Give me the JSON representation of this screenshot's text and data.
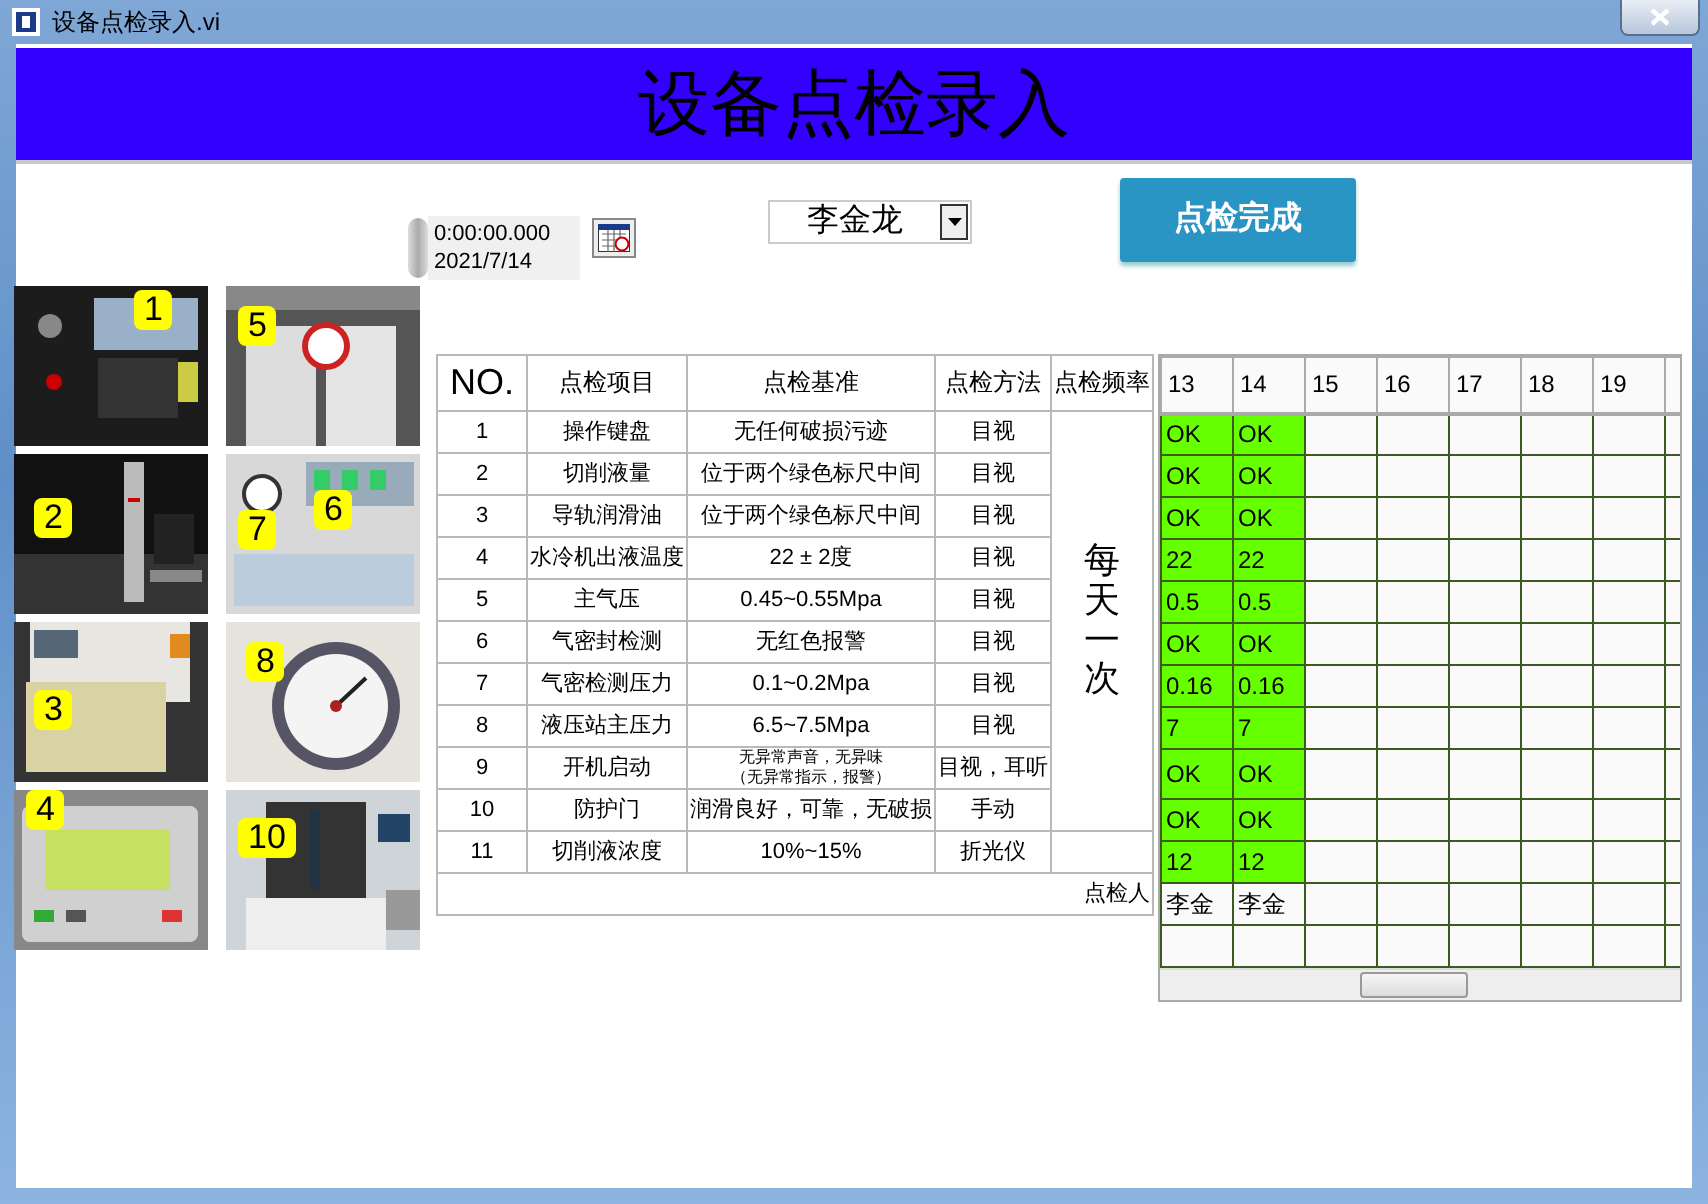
{
  "window": {
    "title": "设备点检录入.vi"
  },
  "banner": {
    "title": "设备点检录入"
  },
  "datetime": {
    "time": "0:00:00.000",
    "date": "2021/7/14"
  },
  "inspector_select": {
    "value": "李金龙"
  },
  "complete_button": {
    "label": "点检完成"
  },
  "photos": [
    {
      "kind": "picture",
      "callouts": [
        "1"
      ]
    },
    {
      "kind": "picture",
      "callouts": [
        "5"
      ]
    },
    {
      "kind": "picture",
      "callouts": [
        "2"
      ]
    },
    {
      "kind": "picture",
      "callouts": [
        "7",
        "6"
      ]
    },
    {
      "kind": "picture",
      "callouts": [
        "3"
      ]
    },
    {
      "kind": "picture",
      "callouts": [
        "8"
      ]
    },
    {
      "kind": "picture",
      "callouts": [
        "4"
      ]
    },
    {
      "kind": "picture",
      "callouts": [
        "10"
      ]
    }
  ],
  "checklist": {
    "columns": [
      "NO.",
      "点检项目",
      "点检基准",
      "点检方法",
      "点检频率"
    ],
    "frequency": "每天一次",
    "rows": [
      {
        "no": "1",
        "item": "操作键盘",
        "standard": "无任何破损污迹",
        "method": "目视"
      },
      {
        "no": "2",
        "item": "切削液量",
        "standard": "位于两个绿色标尺中间",
        "method": "目视"
      },
      {
        "no": "3",
        "item": "导轨润滑油",
        "standard": "位于两个绿色标尺中间",
        "method": "目视"
      },
      {
        "no": "4",
        "item": "水冷机出液温度",
        "standard": "22 ± 2度",
        "method": "目视"
      },
      {
        "no": "5",
        "item": "主气压",
        "standard": "0.45~0.55Mpa",
        "method": "目视"
      },
      {
        "no": "6",
        "item": "气密封检测",
        "standard": "无红色报警",
        "method": "目视"
      },
      {
        "no": "7",
        "item": "气密检测压力",
        "standard": "0.1~0.2Mpa",
        "method": "目视"
      },
      {
        "no": "8",
        "item": "液压站主压力",
        "standard": "6.5~7.5Mpa",
        "method": "目视"
      },
      {
        "no": "9",
        "item": "开机启动",
        "standard": "无异常声音，无异味",
        "standard_line_2": "（无异常指示，报警）",
        "method": "目视，耳听"
      },
      {
        "no": "10",
        "item": "防护门",
        "standard": "润滑良好，可靠，无破损",
        "method": "手动"
      },
      {
        "no": "11",
        "item": "切削液浓度",
        "standard": "10%~15%",
        "method": "折光仪"
      }
    ],
    "footer_label": "点检人"
  },
  "record_grid": {
    "columns": [
      "13",
      "14",
      "15",
      "16",
      "17",
      "18",
      "19"
    ],
    "rows": [
      {
        "values": [
          "OK",
          "OK"
        ]
      },
      {
        "values": [
          "OK",
          "OK"
        ]
      },
      {
        "values": [
          "OK",
          "OK"
        ]
      },
      {
        "values": [
          "22",
          "22"
        ]
      },
      {
        "values": [
          "0.5",
          "0.5"
        ]
      },
      {
        "values": [
          "OK",
          "OK"
        ]
      },
      {
        "values": [
          "0.16",
          "0.16"
        ]
      },
      {
        "values": [
          "7",
          "7"
        ]
      },
      {
        "values": [
          "OK",
          "OK"
        ]
      },
      {
        "values": [
          "OK",
          "OK"
        ]
      },
      {
        "values": [
          "12",
          "12"
        ]
      }
    ],
    "inspectors": [
      "李金",
      "李金"
    ]
  }
}
